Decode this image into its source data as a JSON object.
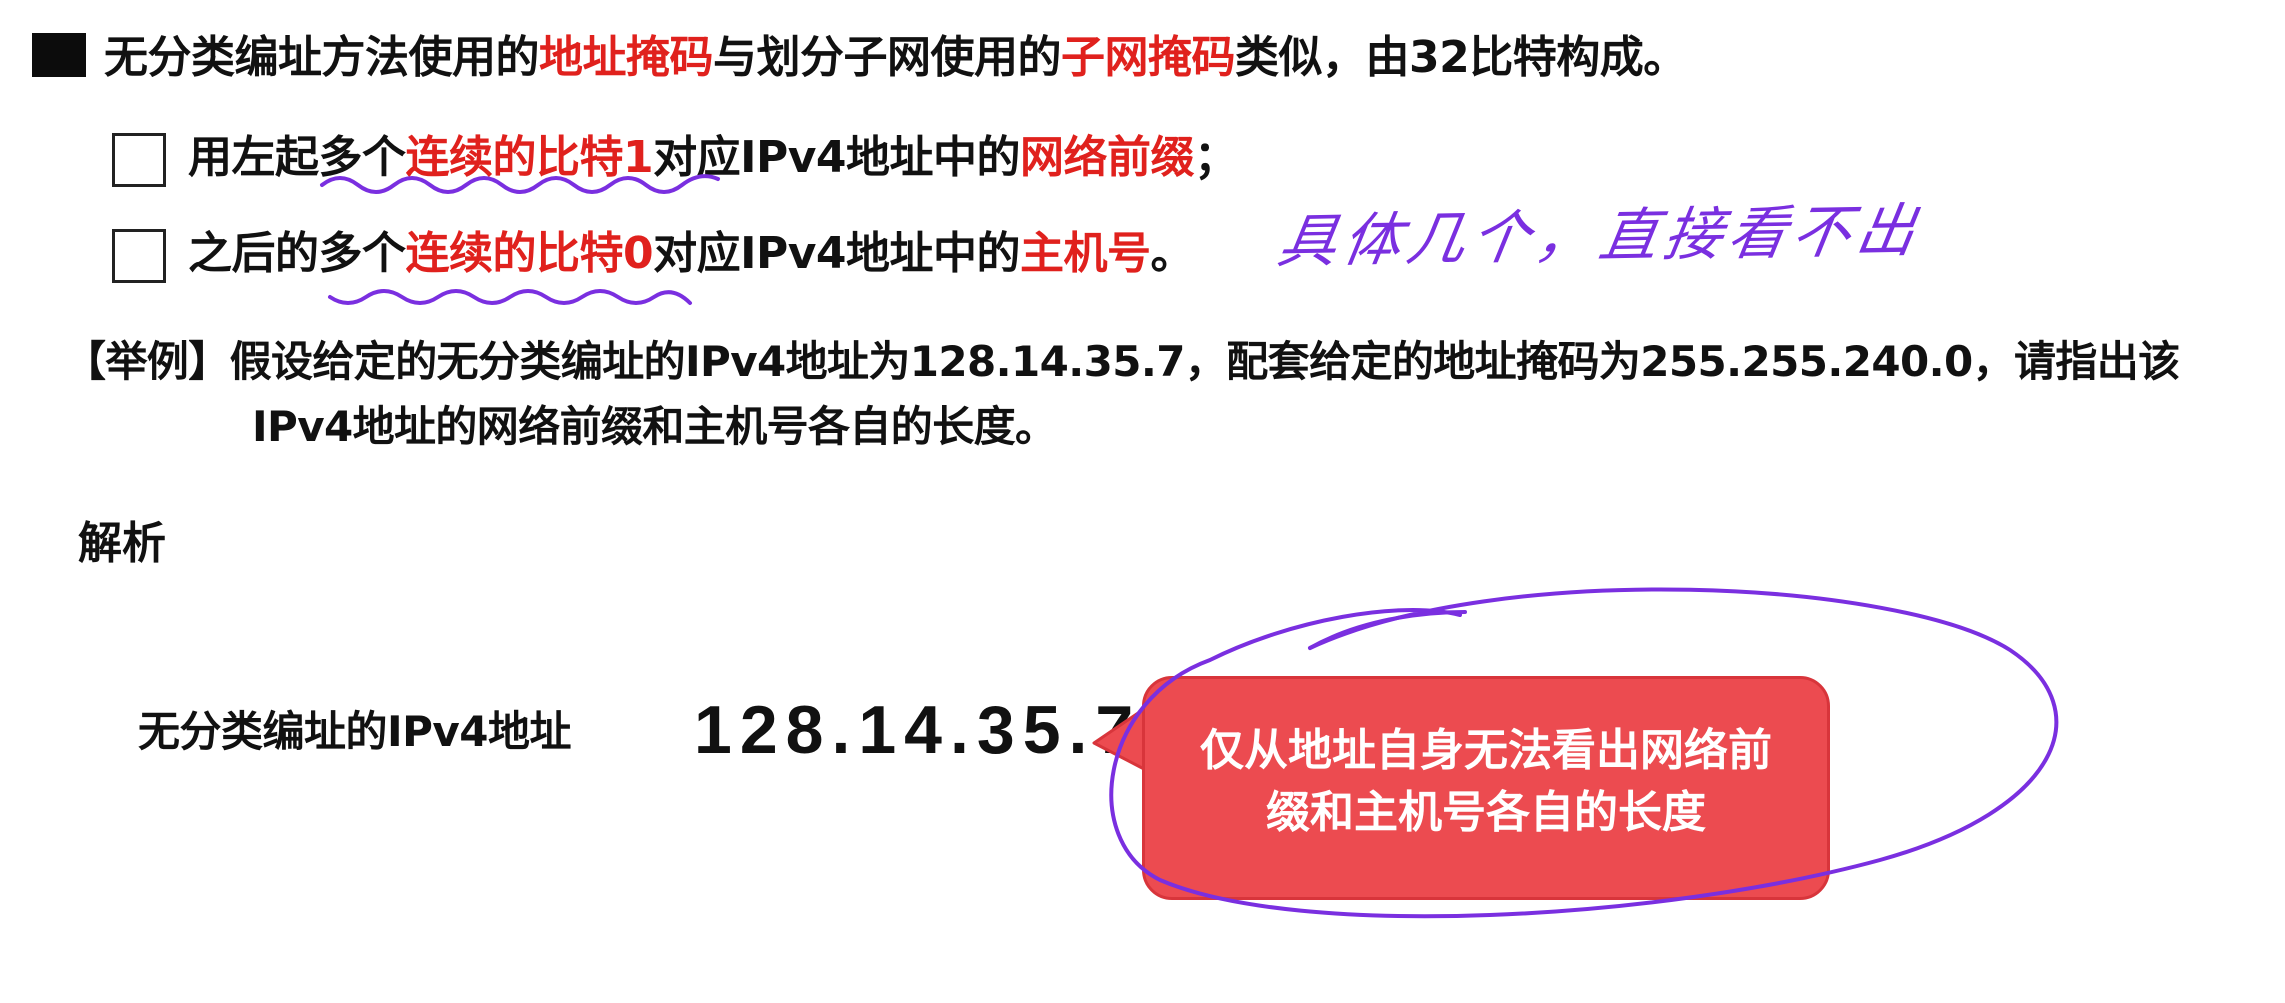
{
  "main_point": {
    "part1": "无分类编址方法使用的",
    "highlight1": "地址掩码",
    "part2": "与划分子网使用的",
    "highlight2": "子网掩码",
    "part3": "类似，由32比特构成。"
  },
  "sub_points": [
    {
      "part1": "用左起多个",
      "highlight1": "连续的比特1",
      "part2": "对应IPv4地址中的",
      "highlight2": "网络前缀",
      "part3": "；"
    },
    {
      "part1": "之后的多个",
      "highlight1": "连续的比特0",
      "part2": "对应IPv4地址中的",
      "highlight2": "主机号",
      "part3": "。"
    }
  ],
  "example": {
    "line1": "【举例】假设给定的无分类编址的IPv4地址为128.14.35.7，配套给定的地址掩码为255.255.240.0，请指出该",
    "line2": "IPv4地址的网络前缀和主机号各自的长度。"
  },
  "analysis": {
    "heading": "解析",
    "ip_label": "无分类编址的IPv4地址",
    "ip_value": "128.14.35.7",
    "callout_line1": "仅从地址自身无法看出网络前",
    "callout_line2": "缀和主机号各自的长度"
  },
  "handwritten_note": "具体几个，直接看不出",
  "colors": {
    "highlight": "#e0211d",
    "callout": "#ec4b50",
    "ink": "#7a2fe0"
  }
}
